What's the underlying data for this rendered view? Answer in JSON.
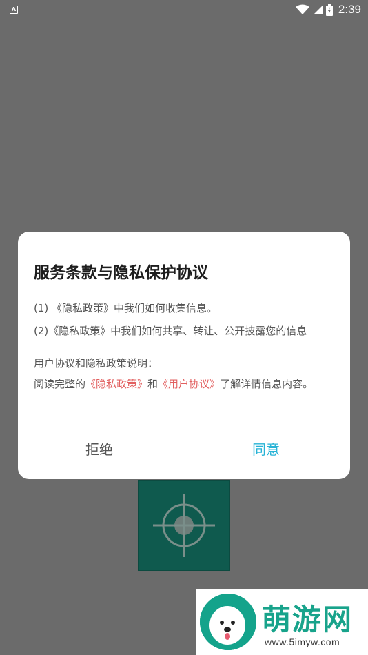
{
  "status_bar": {
    "left_icon": "A",
    "time": "2:39",
    "icons": [
      "wifi-icon",
      "signal-icon",
      "battery-icon"
    ]
  },
  "dialog": {
    "title": "服务条款与隐私保护协议",
    "line1": "(1) 《隐私政策》中我们如何收集信息。",
    "line2": "(2)《隐私政策》中我们如何共享、转让、公开披露您的信息",
    "line3": "用户协议和隐私政策说明：",
    "read_prefix": "阅读完整的",
    "privacy_link": "《隐私政策》",
    "and_text": "和",
    "user_agreement_link": "《用户协议》",
    "read_suffix": "了解详情信息内容。",
    "reject_label": "拒绝",
    "agree_label": "同意"
  },
  "watermark": {
    "title": "萌游网",
    "url": "www.5imyw.com"
  },
  "colors": {
    "overlay": "#6b6b6b",
    "link": "#e26060",
    "agree": "#27b3d6",
    "card": "#0f5a4e"
  }
}
